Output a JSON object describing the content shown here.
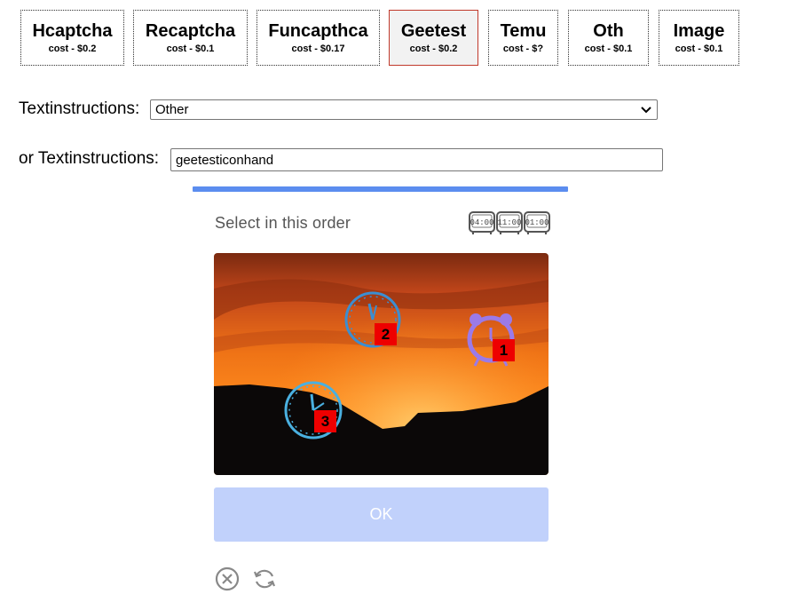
{
  "tabs": [
    {
      "title": "Hcaptcha",
      "cost": "cost - $0.2",
      "active": false
    },
    {
      "title": "Recaptcha",
      "cost": "cost - $0.1",
      "active": false
    },
    {
      "title": "Funcapthca",
      "cost": "cost - $0.17",
      "active": false
    },
    {
      "title": "Geetest",
      "cost": "cost - $0.2",
      "active": true
    },
    {
      "title": "Temu",
      "cost": "cost - $?",
      "active": false
    },
    {
      "title": "Oth",
      "cost": "cost - $0.1",
      "active": false
    },
    {
      "title": "Image",
      "cost": "cost - $0.1",
      "active": false
    }
  ],
  "form": {
    "instructions_label": "Textinstructions:",
    "instructions_selected": "Other",
    "alt_label": "or Textinstructions:",
    "alt_value": "geetesticonhand"
  },
  "captcha": {
    "instruction": "Select in this order",
    "hint_clocks": [
      "04:00",
      "11:00",
      "01:00"
    ],
    "markers": [
      {
        "label": "1"
      },
      {
        "label": "2"
      },
      {
        "label": "3"
      }
    ],
    "ok_label": "OK",
    "accent_color": "#5b8def",
    "ok_color": "#c1d1fb",
    "marker_color": "#ee0000"
  },
  "icons": {
    "close": "close-circle-icon",
    "refresh": "refresh-icon"
  }
}
